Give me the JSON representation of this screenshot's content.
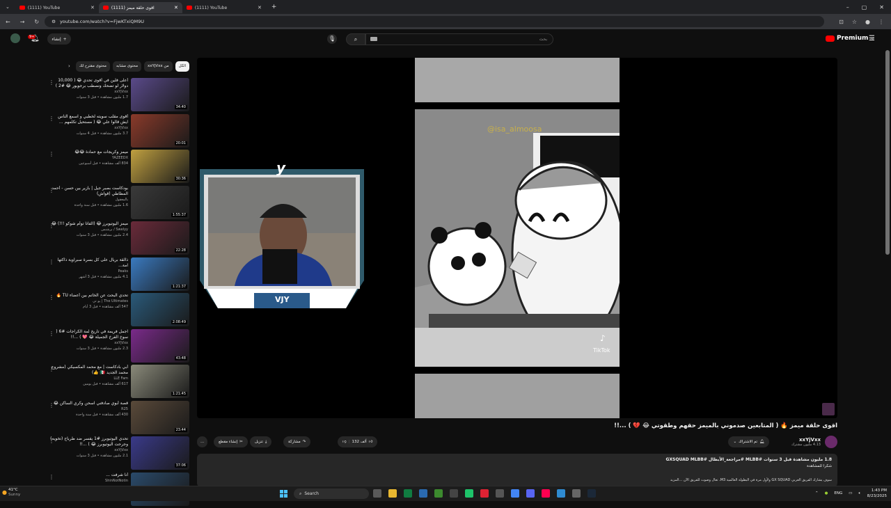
{
  "browser": {
    "tabs": [
      {
        "title": "(1111) YouTube",
        "active": false
      },
      {
        "title": "(1111) اقوى حلقة ميمز",
        "active": true
      },
      {
        "title": "(1111) YouTube",
        "active": false
      }
    ],
    "url": "youtube.com/watch?v=FjwKTxiQM9U",
    "new_tab": "+"
  },
  "header": {
    "create_label": "إنشاء",
    "notif_count": "9+",
    "search_placeholder": "بحث",
    "logo_text": "Premium",
    "logo_region": "AE"
  },
  "chips": [
    "الكل",
    "من xxYjVxx",
    "محتوى مشابه",
    "محتوى مقترح لك"
  ],
  "recommendations": [
    {
      "title": "أعلى فلين في أقوى تحدي 😂 ( 10,000 دولار لو تضحك ونصطب برجويور 😂 #2 )",
      "channel": "xxYjVxx",
      "stats": "1.7 مليون مشاهدة • قبل 3 سنوات",
      "duration": "34:40",
      "color": "#5a4a8a"
    },
    {
      "title": "أقوى مقلب سويته لخطبي و اسمع الناس ايش قالوا علي 😂 ( مستحيل تكلمهم ...",
      "channel": "xxYjVxx",
      "stats": "3.7 مليون مشاهدة • قبل 4 سنوات",
      "duration": "20:01",
      "color": "#8a3a2a"
    },
    {
      "title": "ميمز وكريجات مع حمادة 😂😂",
      "channel": "YAZEEDX",
      "stats": "834 ألف مشاهدة • قبل أسبوعين",
      "duration": "30:36",
      "color": "#c0a040"
    },
    {
      "title": "بودكاست بصبر جيل | بازير بين حسن - أحمد المطاطي (قواش)",
      "channel": "بالمعقول",
      "stats": "1.6 مليون مشاهدة • قبل سنة واحدة",
      "duration": "1:55:37",
      "color": "#3a3a3a"
    },
    {
      "title": "ميمز اليوتيوبرز 😂 (الفاتا توأم شوكو !!!) 😂",
      "channel": "Swelyy / برشنس",
      "stats": "2.4 مليون مشاهدة • قبل 3 سنوات",
      "duration": "22:28",
      "color": "#6a2a3a"
    },
    {
      "title": "ذالقة بريال على كل بسرة سبراوية ذاكتها امة...",
      "channel": "Peaks",
      "stats": "4.1 مليون مشاهدة • قبل 3 أشهر",
      "duration": "1:21:37",
      "color": "#3a7ac0"
    },
    {
      "title": "تحدي البحث عن الخاتم بين أعضاء TU 🔥",
      "channel": "The Ultimates | يو تي",
      "stats": "547 ألف مشاهدة • قبل 3 أيام",
      "duration": "2:08:49",
      "color": "#2a5a7a"
    },
    {
      "title": "اجمل فريمة في تاريخ لمة الكراجات #6 ( سوخ الفرخ الجميلة 😂 💖 ) ...!!",
      "channel": "xxYjVxx",
      "stats": "2.3 مليون مشاهدة • قبل 3 سنوات",
      "duration": "43:48",
      "color": "#7a2a8a"
    },
    {
      "title": "أبي بادكاست | مع محمد المكسيكي (مشروع محمد الجديد 🇲🇽 👍)",
      "channel": "LLE Fam",
      "stats": "617 ألف مشاهدة • قبل يومين",
      "duration": "1:21:45",
      "color": "#8a8a7a"
    },
    {
      "title": "قصة أبوي صادفني اسحن وكري الساكن 😂",
      "channel": "R25",
      "stats": "430 ألف مشاهدة • قبل سنة واحدة",
      "duration": "23:44",
      "color": "#5a4a3a"
    },
    {
      "title": "تحدي اليوتيوبرز #1 يفسر ضد طرباح (تخويه) وجرحت اليوتيوبرز 😂 ) ...!!",
      "channel": "xxYjVxx",
      "stats": "2.1 مليون مشاهدة • قبل 3 سنوات",
      "duration": "37:06",
      "color": "#3a3a8a"
    },
    {
      "title": "أنا شرفت ...",
      "channel": "ShinNotNotin",
      "stats": "",
      "duration": "",
      "color": "#2a4a6a"
    }
  ],
  "player": {
    "watermark": "@isa_almoosa",
    "tiktok_label": "TikTok",
    "cam_tag": "VJY",
    "cam_letter": "y"
  },
  "video": {
    "title": "اقوى حلقة ميمز 🔥 ( المتابعين صدموني بالميمز حقهم وطقوتي 😂 💔 ) ...!!",
    "channel": "xxYjVxx",
    "subscribers": "4.13 مليون مشترك",
    "subscribed_label": "تم الاشتراك",
    "likes": "132 ألف",
    "share_label": "مشاركة",
    "download_label": "تنزيل",
    "clip_label": "إنشاء مقطع",
    "more_label": "..."
  },
  "description": {
    "stats": "1.8 مليون مشاهدة  قبل 3 سنوات  #MLBB #مراجعة_الأبطال #GXSQUAD MLBB",
    "line2": "شكرا للمشاهدة",
    "line3": "سوف يشارك الفريق العربي GX SQUAD ولأول مرة في البطولة العالمية M3، تعال وصوت للفريق الآن ...المزيد"
  },
  "taskbar": {
    "temp": "41°C",
    "condition": "Sunny",
    "search_label": "Search",
    "lang": "ENG",
    "time": "1:43 PM",
    "date": "8/23/2025"
  },
  "colors": {
    "accent": "#ff0000",
    "bg": "#0f0f0f",
    "chip": "#272727"
  }
}
